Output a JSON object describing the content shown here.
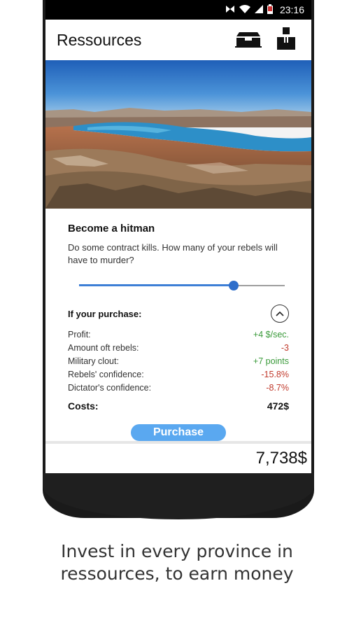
{
  "status_bar": {
    "time": "23:16",
    "icons": [
      "nfc-icon",
      "wifi-icon",
      "signal-icon",
      "battery-icon"
    ]
  },
  "app_bar": {
    "title": "Ressources",
    "actions": [
      "buildings-icon",
      "person-icon"
    ]
  },
  "hero": {
    "description_icon": "landscape-image"
  },
  "card": {
    "title": "Become a hitman",
    "description": "Do some contract kills. How many of your rebels will have to murder?",
    "slider_value": 0.75,
    "purchase_header": "If your purchase:",
    "stats": [
      {
        "label": "Profit:",
        "value": "+4 $/sec.",
        "sign": "pos"
      },
      {
        "label": "Amount oft rebels:",
        "value": "-3",
        "sign": "neg"
      },
      {
        "label": "Military clout:",
        "value": "+7 points",
        "sign": "pos"
      },
      {
        "label": "Rebels' confidence:",
        "value": "-15.8%",
        "sign": "neg"
      },
      {
        "label": "Dictator's confidence:",
        "value": "-8.7%",
        "sign": "neg"
      }
    ],
    "costs_label": "Costs:",
    "costs_value": "472$",
    "purchase_label": "Purchase"
  },
  "footer": {
    "money": "7,738$"
  },
  "caption": {
    "line1": "Invest in every province in",
    "line2": "ressources, to earn money"
  },
  "colors": {
    "accent": "#5aa8f0",
    "slider": "#2e6ecb",
    "positive": "#3a9a3a",
    "negative": "#c0392b"
  }
}
